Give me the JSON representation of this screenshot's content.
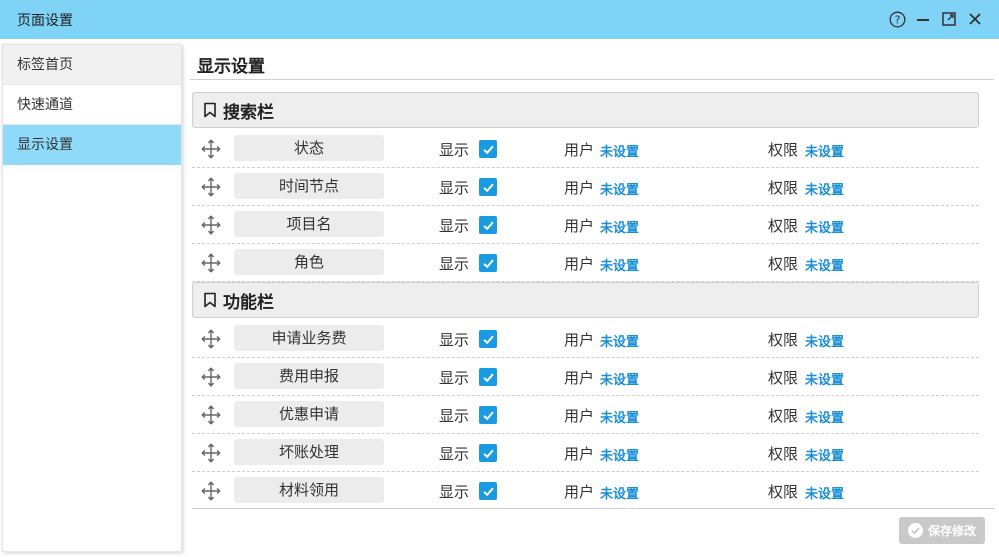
{
  "window": {
    "title": "页面设置",
    "controls": {
      "help": "help-icon",
      "minimize": "minimize-icon",
      "maximize": "maximize-icon",
      "close": "close-icon"
    }
  },
  "sidebar": {
    "items": [
      {
        "label": "标签首页"
      },
      {
        "label": "快速通道"
      },
      {
        "label": "显示设置",
        "active": true
      }
    ]
  },
  "main": {
    "title": "显示设置",
    "sections": [
      {
        "title": "搜索栏",
        "rows": [
          {
            "name": "状态",
            "show_label": "显示",
            "checked": true,
            "user_label": "用户",
            "user_value": "未设置",
            "perm_label": "权限",
            "perm_value": "未设置"
          },
          {
            "name": "时间节点",
            "show_label": "显示",
            "checked": true,
            "user_label": "用户",
            "user_value": "未设置",
            "perm_label": "权限",
            "perm_value": "未设置"
          },
          {
            "name": "项目名",
            "show_label": "显示",
            "checked": true,
            "user_label": "用户",
            "user_value": "未设置",
            "perm_label": "权限",
            "perm_value": "未设置"
          },
          {
            "name": "角色",
            "show_label": "显示",
            "checked": true,
            "user_label": "用户",
            "user_value": "未设置",
            "perm_label": "权限",
            "perm_value": "未设置"
          }
        ]
      },
      {
        "title": "功能栏",
        "rows": [
          {
            "name": "申请业务费",
            "show_label": "显示",
            "checked": true,
            "user_label": "用户",
            "user_value": "未设置",
            "perm_label": "权限",
            "perm_value": "未设置"
          },
          {
            "name": "费用申报",
            "show_label": "显示",
            "checked": true,
            "user_label": "用户",
            "user_value": "未设置",
            "perm_label": "权限",
            "perm_value": "未设置"
          },
          {
            "name": "优惠申请",
            "show_label": "显示",
            "checked": true,
            "user_label": "用户",
            "user_value": "未设置",
            "perm_label": "权限",
            "perm_value": "未设置"
          },
          {
            "name": "坏账处理",
            "show_label": "显示",
            "checked": true,
            "user_label": "用户",
            "user_value": "未设置",
            "perm_label": "权限",
            "perm_value": "未设置"
          },
          {
            "name": "材料领用",
            "show_label": "显示",
            "checked": true,
            "user_label": "用户",
            "user_value": "未设置",
            "perm_label": "权限",
            "perm_value": "未设置"
          }
        ]
      }
    ],
    "save_label": "保存修改"
  },
  "colors": {
    "titlebar": "#7fd3f7",
    "sidebar_active": "#8fdaf9",
    "checkbox": "#1a9ae0",
    "link": "#1a8fd6",
    "save_button": "#c9c9c9"
  }
}
